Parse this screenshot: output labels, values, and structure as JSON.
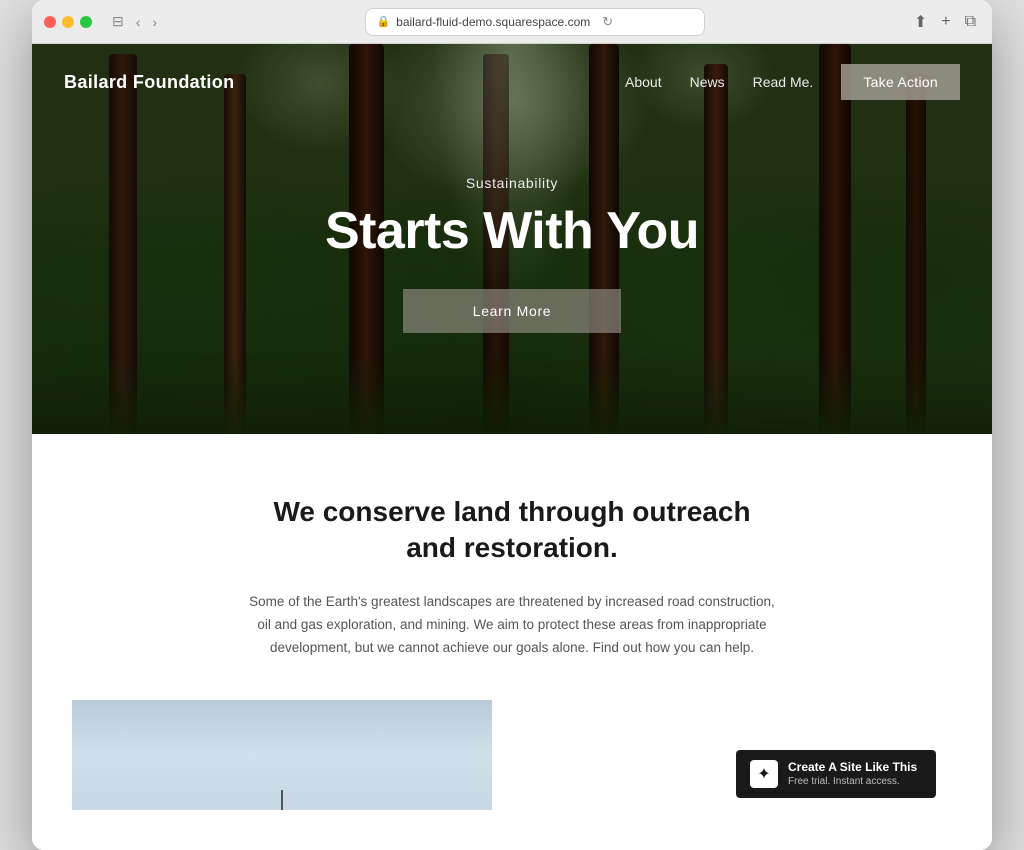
{
  "browser": {
    "url": "bailard-fluid-demo.squarespace.com",
    "back_btn": "‹",
    "forward_btn": "›",
    "reload_btn": "↻",
    "share_btn": "⬆",
    "new_tab_btn": "+",
    "tab_btn": "⧉"
  },
  "navbar": {
    "logo": "Bailard Foundation",
    "links": [
      {
        "label": "About"
      },
      {
        "label": "News"
      },
      {
        "label": "Read Me."
      }
    ],
    "cta": "Take Action"
  },
  "hero": {
    "subtitle": "Sustainability",
    "title": "Starts With You",
    "btn_label": "Learn More"
  },
  "main": {
    "heading": "We conserve land through outreach and restoration.",
    "body": "Some of the Earth's greatest landscapes are threatened by increased road construction, oil and gas exploration, and mining. We aim to protect these areas from inappropriate development, but we cannot achieve our goals alone. Find out how you can help."
  },
  "squarespace": {
    "title": "Create A Site Like This",
    "subtitle": "Free trial. Instant access."
  }
}
